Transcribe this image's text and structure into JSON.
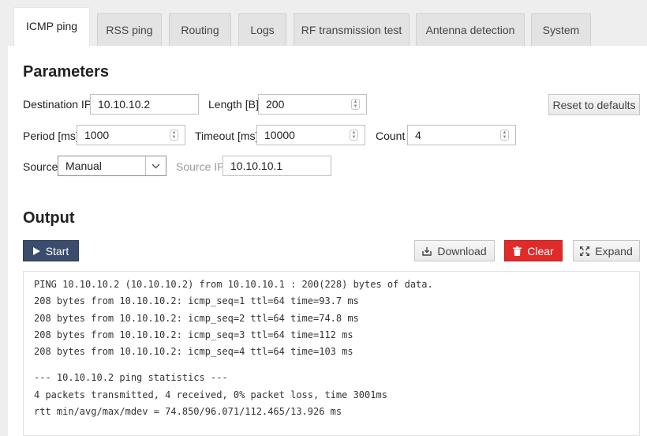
{
  "tabs": [
    "ICMP ping",
    "RSS ping",
    "Routing",
    "Logs",
    "RF transmission test",
    "Antenna detection",
    "System"
  ],
  "parameters": {
    "title": "Parameters",
    "destination_ip_label": "Destination IP",
    "destination_ip_value": "10.10.10.2",
    "length_label": "Length [B]",
    "length_value": "200",
    "reset_label": "Reset to defaults",
    "period_label": "Period [ms]",
    "period_value": "1000",
    "timeout_label": "Timeout [ms]",
    "timeout_value": "10000",
    "count_label": "Count",
    "count_value": "4",
    "source_label": "Source",
    "source_value": "Manual",
    "source_ip_label": "Source IP",
    "source_ip_value": "10.10.10.1"
  },
  "output": {
    "title": "Output",
    "start_label": "Start",
    "download_label": "Download",
    "clear_label": "Clear",
    "expand_label": "Expand",
    "lines": [
      "PING 10.10.10.2 (10.10.10.2) from 10.10.10.1 : 200(228) bytes of data.",
      "208 bytes from 10.10.10.2: icmp_seq=1 ttl=64 time=93.7 ms",
      "208 bytes from 10.10.10.2: icmp_seq=2 ttl=64 time=74.8 ms",
      "208 bytes from 10.10.10.2: icmp_seq=3 ttl=64 time=112 ms",
      "208 bytes from 10.10.10.2: icmp_seq=4 ttl=64 time=103 ms"
    ],
    "stats_lines": [
      "--- 10.10.10.2 ping statistics ---",
      "4 packets transmitted, 4 received, 0% packet loss, time 3001ms",
      "rtt min/avg/max/mdev = 74.850/96.071/112.465/13.926 ms"
    ]
  },
  "colors": {
    "start_button": "#3b4d6d",
    "clear_button": "#e12a2a"
  },
  "icons": {
    "start": "play-icon",
    "download": "download-icon",
    "clear": "trash-icon",
    "expand": "expand-icon"
  }
}
